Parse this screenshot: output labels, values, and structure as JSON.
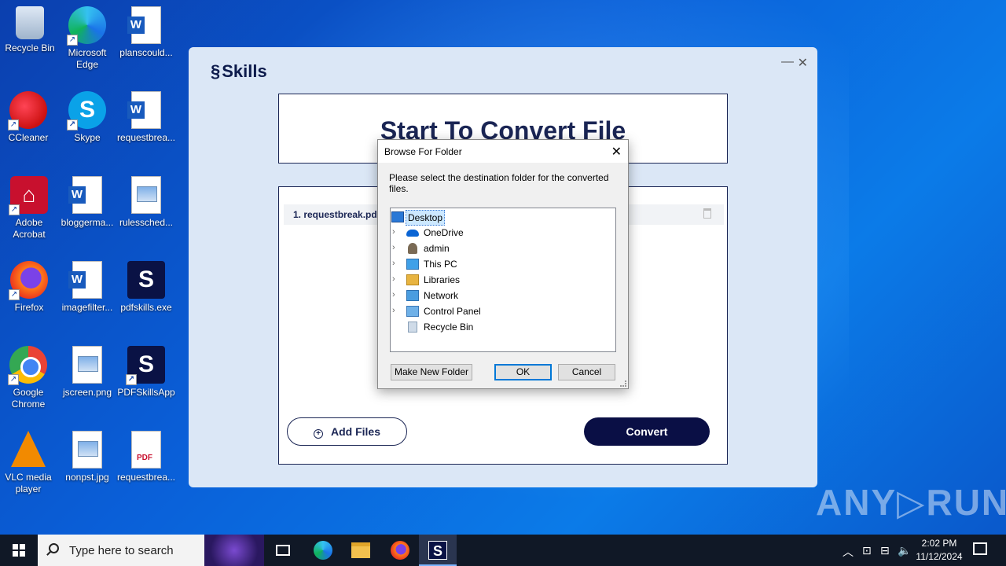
{
  "desktop": {
    "icons": [
      {
        "label": "Recycle Bin",
        "icon": "recycle-bin-icon"
      },
      {
        "label": "Microsoft Edge",
        "icon": "edge-icon"
      },
      {
        "label": "planscould...",
        "icon": "word-doc-icon"
      },
      {
        "label": "CCleaner",
        "icon": "ccleaner-icon"
      },
      {
        "label": "Skype",
        "icon": "skype-icon"
      },
      {
        "label": "requestbrea...",
        "icon": "word-doc-icon"
      },
      {
        "label": "Adobe Acrobat",
        "icon": "acrobat-icon"
      },
      {
        "label": "bloggerma...",
        "icon": "word-doc-icon"
      },
      {
        "label": "rulessched...",
        "icon": "image-file-icon"
      },
      {
        "label": "Firefox",
        "icon": "firefox-icon"
      },
      {
        "label": "imagefilter...",
        "icon": "word-doc-icon"
      },
      {
        "label": "pdfskills.exe",
        "icon": "pdfskills-icon"
      },
      {
        "label": "Google Chrome",
        "icon": "chrome-icon"
      },
      {
        "label": "jscreen.png",
        "icon": "image-file-icon"
      },
      {
        "label": "PDFSkillsApp",
        "icon": "pdfskills-icon"
      },
      {
        "label": "VLC media player",
        "icon": "vlc-icon"
      },
      {
        "label": "nonpst.jpg",
        "icon": "image-file-icon"
      },
      {
        "label": "requestbrea...",
        "icon": "pdf-file-icon"
      }
    ]
  },
  "app": {
    "logo_text": "Skills",
    "title": "Start To Convert File",
    "file_item": "1.  requestbreak.pdf",
    "add_files_label": "Add Files",
    "convert_label": "Convert",
    "minimize_glyph": "—",
    "close_glyph": "✕"
  },
  "dialog": {
    "title": "Browse For Folder",
    "message": "Please select the destination folder for the converted files.",
    "tree": [
      {
        "label": "Desktop",
        "icon": "desktop-icon",
        "selected": true
      },
      {
        "label": "OneDrive",
        "icon": "onedrive-icon"
      },
      {
        "label": "admin",
        "icon": "user-icon"
      },
      {
        "label": "This PC",
        "icon": "pc-icon"
      },
      {
        "label": "Libraries",
        "icon": "libraries-icon"
      },
      {
        "label": "Network",
        "icon": "network-icon"
      },
      {
        "label": "Control Panel",
        "icon": "control-panel-icon"
      },
      {
        "label": "Recycle Bin",
        "icon": "recycle-bin-icon"
      }
    ],
    "new_folder_label": "Make New Folder",
    "ok_label": "OK",
    "cancel_label": "Cancel"
  },
  "taskbar": {
    "search_placeholder": "Type here to search",
    "time": "2:02 PM",
    "date": "11/12/2024",
    "pinned": [
      "task-view",
      "edge",
      "file-explorer",
      "firefox",
      "pdfskills"
    ]
  },
  "watermark": "ANY▷RUN"
}
